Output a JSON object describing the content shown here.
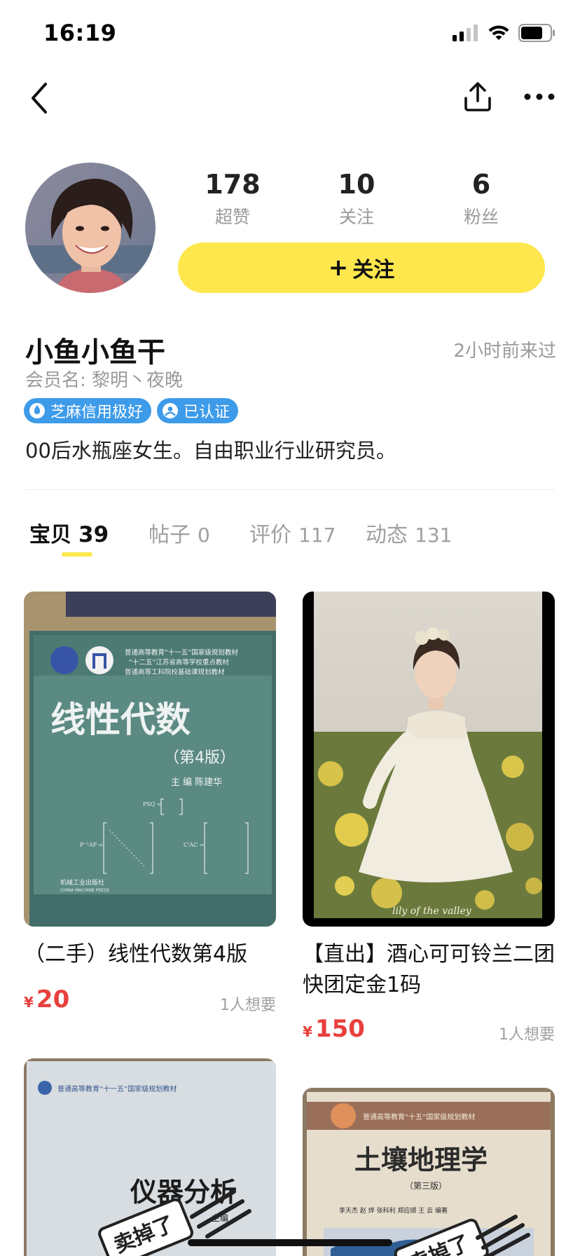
{
  "status_bar": {
    "time": "16:19"
  },
  "nav": {
    "back_icon": "chevron-left-icon",
    "share_icon": "share-upload-icon",
    "more_icon": "ellipsis-icon"
  },
  "profile": {
    "stats": [
      {
        "value": "178",
        "label": "超赞"
      },
      {
        "value": "10",
        "label": "关注"
      },
      {
        "value": "6",
        "label": "粉丝"
      }
    ],
    "follow_button": {
      "plus": "+",
      "label": "关注"
    },
    "nickname": "小鱼小鱼干",
    "last_seen": "2小时前来过",
    "member_name": "会员名: 黎明丶夜晚",
    "badges": [
      {
        "label": "芝麻信用极好",
        "icon": "flame-drop-icon"
      },
      {
        "label": "已认证",
        "icon": "verified-person-icon"
      }
    ],
    "bio": "00后水瓶座女生。自由职业行业研究员。"
  },
  "tabs": [
    {
      "label": "宝贝",
      "count": "39",
      "active": true
    },
    {
      "label": "帖子",
      "count": "0",
      "active": false
    },
    {
      "label": "评价",
      "count": "117",
      "active": false
    },
    {
      "label": "动态",
      "count": "131",
      "active": false
    }
  ],
  "items": [
    {
      "title": "（二手）线性代数第4版",
      "price_symbol": "¥",
      "price": "20",
      "wants": "1人想要",
      "image": {
        "header_lines": [
          "普通高等教育“十一五”国家级规划教材",
          "“十二五”江苏省高等学校重点教材",
          "普通高等工科院校基础课规划教材"
        ],
        "title": "线性代数",
        "edition": "（第4版）",
        "author": "主  编    陈建华",
        "publisher": "机械工业出版社",
        "publisher_en": "CHINA MACHINE PRESS"
      }
    },
    {
      "title": "【直出】酒心可可铃兰二团快团定金1码",
      "price_symbol": "¥",
      "price": "150",
      "wants": "1人想要",
      "image": {
        "caption": "lily of the valley"
      }
    },
    {
      "image": {
        "header": "普通高等教育“十一五”国家级规划教材",
        "title": "仪器分析",
        "editor": "主编",
        "stamp": "卖掉了"
      }
    },
    {
      "image": {
        "header": "普通高等教育“十五”国家级规划教材",
        "title": "土壤地理学",
        "edition": "（第三版）",
        "authors": "李天杰  赵  烨  张科利  郑应顺  王  云  编著",
        "stamp": "卖掉了"
      }
    }
  ]
}
